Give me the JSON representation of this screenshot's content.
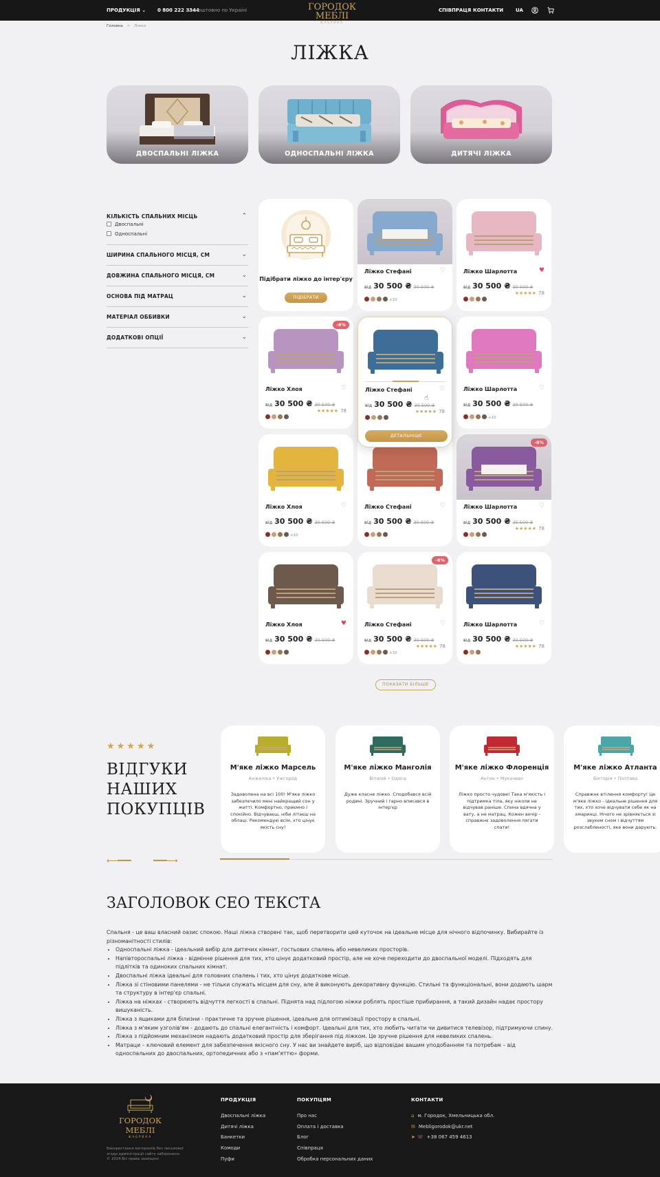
{
  "header": {
    "menu_products": "ПРОДУКЦІЯ",
    "phone": "0 800 222 3344",
    "phone_note": "Безкоштовно по Україні",
    "logo": "ГОРОДОК МЕБЛІ",
    "logo_sub": "ФАБРИКА",
    "nav": [
      "СПІВПРАЦЯ",
      "КОНТАКТИ"
    ],
    "lang": "UA"
  },
  "breadcrumb": [
    "Головна",
    "Ліжка"
  ],
  "page_title": "ЛІЖКА",
  "categories": [
    "ДВОСПАЛЬНІ ЛІЖКА",
    "ОДНОСПАЛЬНІ ЛІЖКА",
    "ДИТЯЧІ ЛІЖКА"
  ],
  "filters": {
    "sections": [
      "КІЛЬКІСТЬ СПАЛЬНИХ МІСЦЬ",
      "ШИРИНА СПАЛЬНОГО МІСЦЯ, СМ",
      "ДОВЖИНА СПАЛЬНОГО МІСЦЯ, СМ",
      "ОСНОВА ПІД МАТРАЦ",
      "МАТЕРІАЛ ОББИВКИ",
      "ДОДАТКОВІ ОПЦІЇ"
    ],
    "options": [
      "Двоспальні",
      "Односпальні"
    ]
  },
  "promo": {
    "text": "Підібрати ліжко до інтер'єру",
    "button": "ПІДІБРАТИ"
  },
  "products": [
    {
      "name": "Ліжко Стефані",
      "from": "від",
      "price": "30 500 ₴",
      "old": "30 500 ₴",
      "more": "+10",
      "rating": "",
      "count": "",
      "fav": false,
      "disc": "",
      "img": "#87a9cf",
      "colors": [
        "#8b2f25",
        "#c9a07a",
        "#9a7656",
        "#6b5a52"
      ]
    },
    {
      "name": "Ліжко Шарлотта",
      "from": "від",
      "price": "30 500 ₴",
      "old": "30 500 ₴",
      "more": "",
      "rating": "★★★★★",
      "count": "78",
      "fav": true,
      "disc": "",
      "img": "#e7b8c3",
      "colors": [
        "#8b2f25",
        "#c9a07a",
        "#9a7656",
        "#6b5a52"
      ]
    },
    {
      "name": "Ліжко Хлоя",
      "from": "від",
      "price": "30 500 ₴",
      "old": "30 500 ₴",
      "more": "",
      "rating": "★★★★★",
      "count": "78",
      "fav": false,
      "disc": "-8%",
      "img": "#b894c0",
      "colors": [
        "#8b2f25",
        "#c9a07a",
        "#9a7656",
        "#6b5a52"
      ]
    },
    {
      "name": "Ліжко Стефані",
      "from": "від",
      "price": "30 500 ₴",
      "old": "30 500 ₴",
      "more": "",
      "rating": "★★★★★",
      "count": "78",
      "fav": false,
      "disc": "",
      "img": "#3d6e98",
      "colors": [
        "#8b2f25",
        "#c9a07a",
        "#9a7656",
        "#6b5a52"
      ]
    },
    {
      "name": "Ліжко Шарлотта",
      "from": "від",
      "price": "30 500 ₴",
      "old": "30 500 ₴",
      "more": "+10",
      "rating": "",
      "count": "",
      "fav": false,
      "disc": "",
      "img": "#e078c0",
      "colors": [
        "#8b2f25",
        "#c9a07a",
        "#9a7656",
        "#6b5a52"
      ]
    },
    {
      "name": "Ліжко Хлоя",
      "from": "від",
      "price": "30 500 ₴",
      "old": "30 500 ₴",
      "more": "+10",
      "rating": "",
      "count": "",
      "fav": false,
      "disc": "",
      "img": "#e3b43e",
      "colors": [
        "#8b2f25",
        "#c9a07a",
        "#9a7656",
        "#6b5a52"
      ]
    },
    {
      "name": "Ліжко Стефані",
      "from": "від",
      "price": "30 500 ₴",
      "old": "30 500 ₴",
      "more": "",
      "rating": "",
      "count": "",
      "fav": false,
      "disc": "",
      "img": "#c26a58",
      "colors": [
        "#8b2f25",
        "#c9a07a",
        "#9a7656",
        "#6b5a52"
      ]
    },
    {
      "name": "Ліжко Шарлотта",
      "from": "від",
      "price": "30 500 ₴",
      "old": "35 500 ₴",
      "more": "",
      "rating": "★★★★★",
      "count": "78",
      "fav": false,
      "disc": "-8%",
      "img": "#8a5a9e",
      "colors": [
        "#8b2f25",
        "#c9a07a",
        "#9a7656",
        "#6b5a52"
      ]
    },
    {
      "name": "Ліжко Хлоя",
      "from": "від",
      "price": "30 500 ₴",
      "old": "30 500 ₴",
      "more": "",
      "rating": "",
      "count": "",
      "fav": true,
      "disc": "",
      "img": "#6e5a4d",
      "colors": [
        "#8b2f25",
        "#c9a07a",
        "#9a7656",
        "#6b5a52"
      ]
    },
    {
      "name": "Ліжко Стефані",
      "from": "від",
      "price": "30 500 ₴",
      "old": "30 500 ₴",
      "more": "+10",
      "rating": "★★★★★",
      "count": "78",
      "fav": false,
      "disc": "-8%",
      "img": "#eadbcf",
      "colors": [
        "#8b2f25",
        "#c9a07a",
        "#9a7656",
        "#6b5a52"
      ]
    },
    {
      "name": "Ліжко Шарлотта",
      "from": "від",
      "price": "30 500 ₴",
      "old": "30 500 ₴",
      "more": "",
      "rating": "★★★★★",
      "count": "78",
      "fav": false,
      "disc": "",
      "img": "#3c527a",
      "colors": [
        "#8b2f25",
        "#c9a07a",
        "#9a7656"
      ]
    }
  ],
  "details_button": "ДЕТАЛЬНІШЕ",
  "show_more": "ПОКАЗАТИ БІЛЬШЕ",
  "reviews": {
    "stars": "★★★★★",
    "title": "ВІДГУКИ НАШИХ ПОКУПЦІВ",
    "items": [
      {
        "name": "М'яке ліжко Марсель",
        "author": "Анжеліка • Ужгород",
        "text": "Задоволена на всі 100! М'яке ліжко забезпечило мені найкращий сон у житті. Комфортно, приємно і спокійно. Відчуваєш, ніби літаєш на облаці. Рекомендую всім, хто цінує якість сну!",
        "color": "#b8ad2c"
      },
      {
        "name": "М'яке ліжко Манголія",
        "author": "Віталій • Одеса",
        "text": "Дуже класне ліжко. Сподобався всій родині. Зручний і гарно вписався в інтер'єр",
        "color": "#2f6b5e"
      },
      {
        "name": "М'яке ліжко Флоренція",
        "author": "Антон • Мукачево",
        "text": "Ліжко просто чудове! Така м'якість і підтримка тіла, яку ніколи не відчував раніше. Спина вдячна у вату, а не матрац. Кожен вечір - справжнє задоволення лягати спати!",
        "color": "#c22a33"
      },
      {
        "name": "М'яке ліжко Атланта",
        "author": "Вікторія • Полтава",
        "text": "Справжнє втілення комфорту! Це м'яке ліжко - ідеальне рішення для тих, хто хоче відчувати себе як на хмаринці. Нічого не зрівняється зі звуком сном і відчуттям розслабленості, яке вони дарують.",
        "color": "#4aa6a8"
      }
    ]
  },
  "seo": {
    "title": "ЗАГОЛОВОК СЕО ТЕКСТА",
    "intro": "Спальня - це ваш власний оазис спокою. Наші ліжка створені так, щоб перетворити цей куточок на ідеальне місце для нічного відпочинку. Вибирайте із різноманітності стилів:",
    "items": [
      "Односпальні ліжка - ідеальний вибір для дитячих кімнат, гостьових спалень або невеликих просторів.",
      "Напівтороспальні ліжка - відмінне рішення для тих, хто цінує додатковий простір, але не хоче переходити до двоспальної моделі. Підходять для підлітків та одиноких спальних кімнат.",
      "Двоспальні ліжка ідеальні для головних спалень і тих, хто цінує додаткове місце.",
      "Ліжка зі стіновими панелями - не тільки служать місцем для сну, але й виконують декоративну функцію. Стильні та функціональні, вони додають шарм та структуру в інтер'єр спальні.",
      "Ліжка на ніжках - створюють відчуття легкості в спальні. Піднята над підлогою ніжки роблять простіше прибирання, а такий дизайн надає простору вишуканість.",
      "Ліжка з ящиками для білизни - практичне та зручне рішення, ідеальне для оптимізації простору в спальні.",
      "Ліжка з м'яким узголів'ям - додають до спальні елегантність і комфорт. Ідеальні для тих, хто любить читати чи дивитися телевізор, підтримуючи спину.",
      "Ліжка з підйомним механізмом надають додатковий простір для зберігання під ліжком. Це зручне рішення для невеликих спалень.",
      "Матраци – ключовий елемент для забезпечення якісного сну. У нас ви знайдете виріб, що відповідає вашим уподобанням та потребам – від односпальних до двоспальних, ортопедичних або з «пам'яттю» форми."
    ]
  },
  "footer": {
    "logo": "ГОРОДОК МЕБЛІ",
    "logo_sub": "ФАБРИКА",
    "legal": [
      "Використання матеріалів без письмової",
      "згоди адміністрації сайту заборонено.",
      "© 2024 Всі права захищені"
    ],
    "col1_title": "ПРОДУКЦІЯ",
    "col1": [
      "Двоспальні ліжка",
      "Дитячі ліжка",
      "Банкетки",
      "Комоди",
      "Пуфи"
    ],
    "col2_title": "ПОКУПЦЯМ",
    "col2": [
      "Про нас",
      "Оплата і доставка",
      "Блог",
      "Співпраця",
      "Обробка персональних даних"
    ],
    "col3_title": "КОНТАКТИ",
    "address": "м. Городок, Хмельницька обл.",
    "email": "Mebligorodok@ukr.net",
    "phone": "+38 067 459 4613"
  },
  "colors": {
    "accent": "#c9a45c",
    "dark": "#171717",
    "sale": "#e0636c",
    "background": "#f1f0f2"
  }
}
